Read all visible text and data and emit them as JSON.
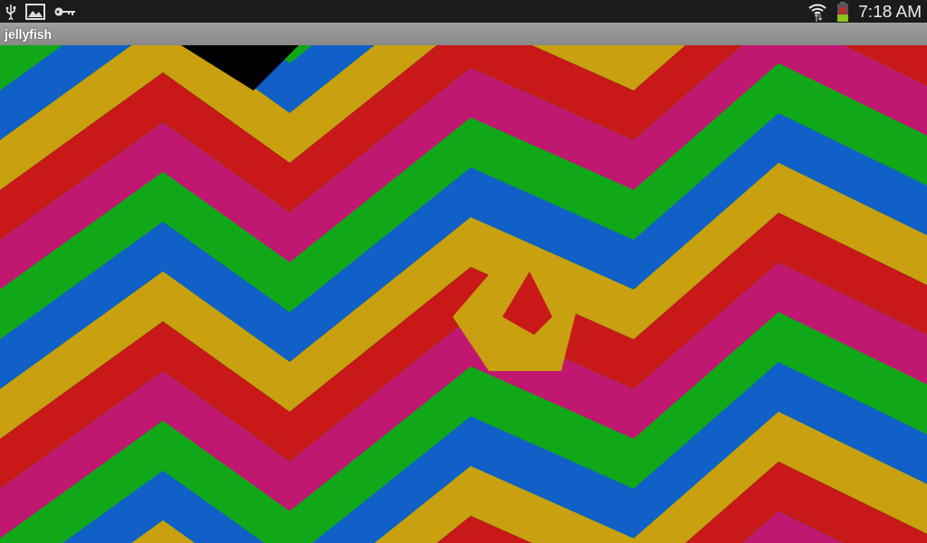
{
  "status_bar": {
    "time": "7:18 AM"
  },
  "title_bar": {
    "title": "jellyfish"
  }
}
